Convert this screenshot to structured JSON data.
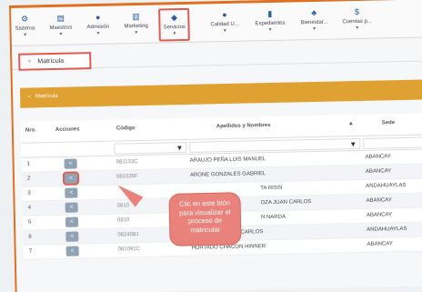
{
  "menu": [
    {
      "label": "Sistema",
      "icon": "gears-icon",
      "glyph": "⚙"
    },
    {
      "label": "Maestros",
      "icon": "database-icon",
      "glyph": "▤"
    },
    {
      "label": "Admisión",
      "icon": "user-icon",
      "glyph": "●"
    },
    {
      "label": "Marketing",
      "icon": "chart-icon",
      "glyph": "▥"
    },
    {
      "label": "Servicios",
      "icon": "graduation-cap-icon",
      "glyph": "◆"
    },
    {
      "label": "Calidad U...",
      "icon": "circle-icon",
      "glyph": "●"
    },
    {
      "label": "Expedientes",
      "icon": "document-icon",
      "glyph": "▮"
    },
    {
      "label": "Bienestar...",
      "icon": "users-icon",
      "glyph": "♣"
    },
    {
      "label": "Cuentas p...",
      "icon": "dollar-icon",
      "glyph": "$"
    }
  ],
  "tab": {
    "close": "×",
    "label": "Matrícula"
  },
  "panel": {
    "title": "Matrícula"
  },
  "table": {
    "columns": [
      "Nro.",
      "Acciones",
      "Código",
      "Apellidos y Nombres",
      "Sede"
    ],
    "sort_indicator": "▲",
    "rows": [
      {
        "nro": "1",
        "code": "981133C",
        "name": "ARAUJO PEÑA LUIS MANUEL",
        "sede": "ABANCAY"
      },
      {
        "nro": "2",
        "code": "081026F",
        "name": "ARONE GONZALES GABRIEL",
        "sede": "ABANCAY"
      },
      {
        "nro": "3",
        "code": "",
        "name": "TA RISSI",
        "sede": "ANDAHUAYLAS"
      },
      {
        "nro": "4",
        "code": "0810",
        "name": "OZA JUAN CARLOS",
        "sede": "ABANCAY"
      },
      {
        "nro": "5",
        "code": "0810",
        "name": "N NARDA",
        "sede": "ABANCAY"
      },
      {
        "nro": "6",
        "code": "082408J",
        "name": "HUAMAN HUANCA CARLOS",
        "sede": "ANDAHUAYLAS"
      },
      {
        "nro": "7",
        "code": "081091C",
        "name": "HURTADO CHACON HINNER",
        "sede": "ABANCAY"
      }
    ]
  },
  "callout": {
    "text": "Clic en este btón para visualizar el proceso de matricular"
  }
}
